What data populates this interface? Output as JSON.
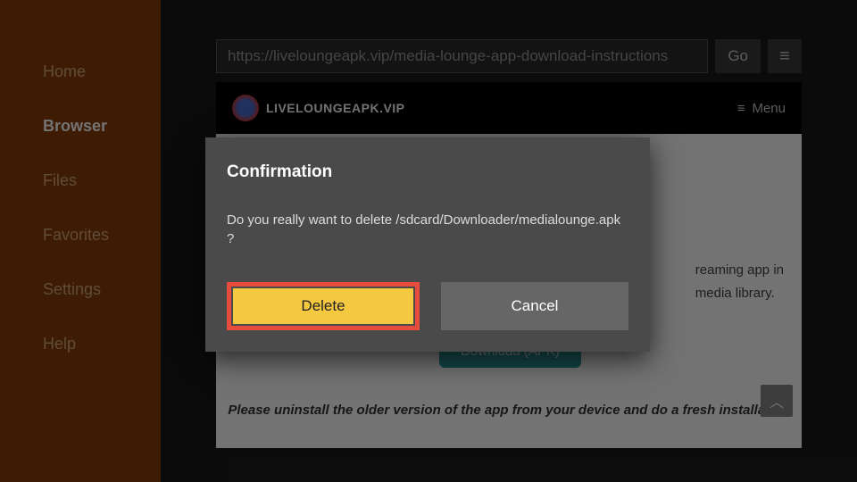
{
  "sidebar": {
    "items": [
      {
        "label": "Home"
      },
      {
        "label": "Browser"
      },
      {
        "label": "Files"
      },
      {
        "label": "Favorites"
      },
      {
        "label": "Settings"
      },
      {
        "label": "Help"
      }
    ],
    "active_index": 1
  },
  "toolbar": {
    "url": "https://liveloungeapk.vip/media-lounge-app-download-instructions",
    "go_label": "Go"
  },
  "site": {
    "brand": "LIVELOUNGEAPK.VIP",
    "menu_label": "Menu"
  },
  "page": {
    "streaming_line1": "reaming app in",
    "streaming_line2": "media library.",
    "download_btn": "Download (APK)",
    "uninstall_note": "Please uninstall the older version of the app from your device and do a fresh installation",
    "scroll_top": "︿"
  },
  "dialog": {
    "title": "Confirmation",
    "message": "Do you really want to delete /sdcard/Downloader/medialounge.apk ?",
    "delete_label": "Delete",
    "cancel_label": "Cancel"
  }
}
